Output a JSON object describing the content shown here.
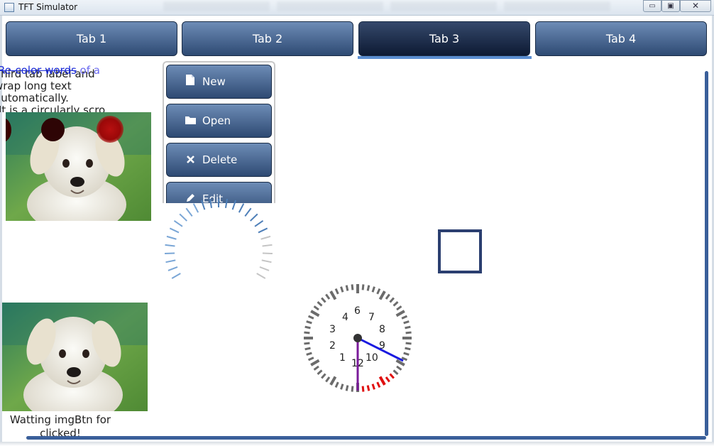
{
  "window": {
    "title": "TFT Simulator",
    "controls": {
      "minimize": "▭",
      "maximize": "▣",
      "close": "✕"
    }
  },
  "tabs": [
    {
      "label": "Tab 1"
    },
    {
      "label": "Tab 2"
    },
    {
      "label": "Tab 3",
      "active": true
    },
    {
      "label": "Tab 4"
    }
  ],
  "label_panel": {
    "recolor_part1": "Re-color words",
    "recolor_part2": " of a",
    "wrap_text": "Third tab label and  wrap long text automatically.",
    "scroll_text": "It is a circularly scro"
  },
  "button_list": [
    {
      "label": "New",
      "icon": "file-icon"
    },
    {
      "label": "Open",
      "icon": "folder-icon"
    },
    {
      "label": "Delete",
      "icon": "close-icon"
    },
    {
      "label": "Edit",
      "icon": "pencil-icon"
    }
  ],
  "clock": {
    "numbers": [
      "1",
      "2",
      "3",
      "4",
      "6",
      "7",
      "8",
      "9",
      "10",
      "12"
    ]
  },
  "status": {
    "message": "Watting imgBtn for clicked!"
  },
  "colors": {
    "tab_gradient_top": "#6d8cb6",
    "tab_gradient_bottom": "#2e4a73",
    "tab_active_bottom": "#0d1a33",
    "indicator": "#5b8ed1",
    "scrollbar": "#3a5f9a",
    "square": "#2b3f70",
    "led_dark": "#3a0000",
    "led_bright": "#c01010"
  }
}
